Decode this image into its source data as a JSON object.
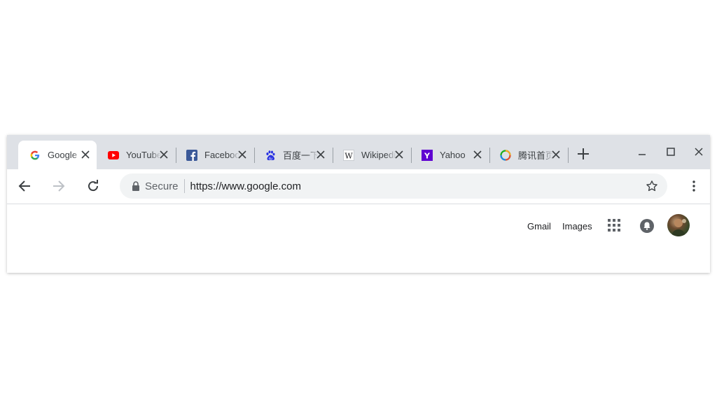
{
  "tabs": [
    {
      "title": "Google",
      "icon": "google-icon",
      "active": true
    },
    {
      "title": "YouTube",
      "icon": "youtube-icon",
      "active": false
    },
    {
      "title": "Facebook",
      "icon": "facebook-icon",
      "active": false
    },
    {
      "title": "百度一下",
      "icon": "baidu-icon",
      "active": false
    },
    {
      "title": "Wikipedia",
      "icon": "wikipedia-icon",
      "active": false
    },
    {
      "title": "Yahoo",
      "icon": "yahoo-icon",
      "active": false
    },
    {
      "title": "腾讯首页",
      "icon": "tencent-icon",
      "active": false
    }
  ],
  "omnibox": {
    "security_label": "Secure",
    "url": "https://www.google.com"
  },
  "page": {
    "gmail_label": "Gmail",
    "images_label": "Images"
  },
  "colors": {
    "tabstrip_bg": "#dee1e6",
    "omnibox_bg": "#f1f3f4",
    "youtube_red": "#ff0000",
    "facebook_blue": "#3b5998",
    "yahoo_purple": "#5f01d1",
    "baidu_blue": "#2932e1"
  }
}
